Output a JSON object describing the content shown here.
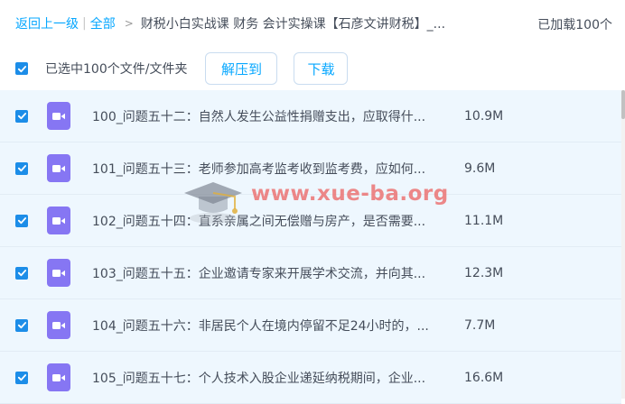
{
  "breadcrumb": {
    "back": "返回上一级",
    "separator": "|",
    "all": "全部",
    "arrow": ">",
    "current": "财税小白实战课 财务 会计实操课【石彦文讲财税】_..."
  },
  "loaded_count": "已加载100个",
  "toolbar": {
    "selection_text": "已选中100个文件/文件夹",
    "extract_label": "解压到",
    "download_label": "下载"
  },
  "files": [
    {
      "name": "100_问题五十二：自然人发生公益性捐赠支出，应取得什...",
      "size": "10.9M"
    },
    {
      "name": "101_问题五十三：老师参加高考监考收到监考费，应如何...",
      "size": "9.6M"
    },
    {
      "name": "102_问题五十四：直系亲属之间无偿赠与房产，是否需要...",
      "size": "11.1M"
    },
    {
      "name": "103_问题五十五：企业邀请专家来开展学术交流，并向其...",
      "size": "12.3M"
    },
    {
      "name": "104_问题五十六：非居民个人在境内停留不足24小时的，...",
      "size": "7.7M"
    },
    {
      "name": "105_问题五十七：个人技术入股企业递延纳税期间，企业...",
      "size": "16.6M"
    }
  ],
  "watermark": {
    "text": "www.xue-ba.org",
    "icon": "graduation-cap-icon"
  },
  "colors": {
    "link": "#06a7ff",
    "checkbox": "#1c8de8",
    "row_bg": "#eef7fe",
    "video_icon": "#8676f3"
  }
}
